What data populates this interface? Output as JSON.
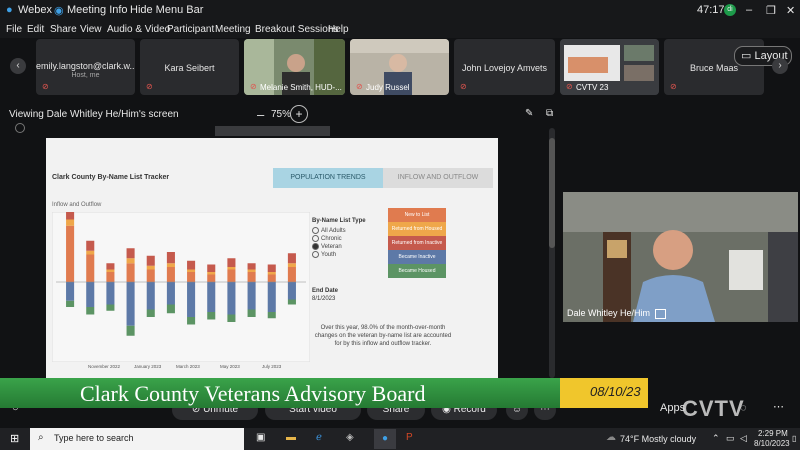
{
  "titlebar": {
    "app": "Webex",
    "meeting_info": "Meeting Info",
    "hide_menu": "Hide Menu Bar",
    "timer": "47:17"
  },
  "menu": [
    "File",
    "Edit",
    "Share",
    "View",
    "Audio & Video",
    "Participant",
    "Meeting",
    "Breakout Sessions",
    "Help"
  ],
  "participants": [
    {
      "name": "emily.langston@clark.w...",
      "sub": "Host, me",
      "type": "name"
    },
    {
      "name": "Kara Seibert",
      "sub": "",
      "type": "name"
    },
    {
      "name": "",
      "caption": "Melanie Smith, HUD-...",
      "type": "video"
    },
    {
      "name": "",
      "caption": "Judy Russel",
      "type": "video"
    },
    {
      "name": "John Lovejoy Amvets",
      "sub": "",
      "type": "name"
    },
    {
      "name": "",
      "caption": "CVTV 23",
      "type": "video"
    },
    {
      "name": "Bruce Maas",
      "sub": "",
      "type": "name"
    }
  ],
  "layout_label": "Layout",
  "viewing": "Viewing Dale Whitley He/Him's screen",
  "zoom": "75%",
  "tracker": {
    "title": "Clark County By-Name List Tracker",
    "tab_active": "POPULATION TRENDS",
    "tab_inactive": "INFLOW AND OUTFLOW",
    "chart_title": "Inflow and Outflow",
    "filter_title": "By-Name List Type",
    "options": [
      "All Adults",
      "Chronic",
      "Veteran",
      "Youth"
    ],
    "selected": "Veteran",
    "legend": [
      {
        "label": "New to List",
        "color": "#e07b4f"
      },
      {
        "label": "Returned from Housed",
        "color": "#efa74a"
      },
      {
        "label": "Returned from Inactive",
        "color": "#c55a4d"
      },
      {
        "label": "Became Inactive",
        "color": "#5d79a7"
      },
      {
        "label": "Became Housed",
        "color": "#5c9464"
      }
    ],
    "end_date_label": "End Date",
    "end_date": "8/1/2023",
    "note": "Over this year, 98.0% of the month-over-month changes on the veteran by-name list are accounted for by this inflow and outflow tracker.",
    "x_ticks": [
      "November 2022",
      "January 2023",
      "March 2023",
      "May 2023",
      "July 2023"
    ]
  },
  "chart_data": {
    "type": "bar",
    "title": "Inflow and Outflow",
    "categories": [
      "",
      "",
      "",
      "",
      "",
      "",
      "",
      "",
      "",
      "",
      "",
      ""
    ],
    "series": [
      {
        "name": "New to List",
        "values": [
          45,
          22,
          8,
          15,
          10,
          12,
          8,
          6,
          10,
          8,
          6,
          12
        ]
      },
      {
        "name": "Returned from Housed",
        "values": [
          5,
          3,
          2,
          4,
          3,
          3,
          2,
          2,
          2,
          2,
          2,
          3
        ]
      },
      {
        "name": "Returned from Inactive",
        "values": [
          12,
          8,
          5,
          8,
          8,
          9,
          7,
          6,
          7,
          5,
          6,
          8
        ]
      },
      {
        "name": "Became Inactive",
        "values": [
          -15,
          -20,
          -18,
          -35,
          -22,
          -18,
          -28,
          -24,
          -26,
          -22,
          -24,
          -14
        ]
      },
      {
        "name": "Became Housed",
        "values": [
          -5,
          -6,
          -5,
          -8,
          -6,
          -7,
          -6,
          -6,
          -6,
          -6,
          -5,
          -4
        ]
      }
    ]
  },
  "presenter_caption": "Dale Whitley He/Him",
  "banner": {
    "title": "Clark County Veterans Advisory Board",
    "date": "08/10/23",
    "brand": "CVTV"
  },
  "controls": [
    "Unmute",
    "Start video",
    "Share",
    "Record",
    "Apps"
  ],
  "taskbar": {
    "search": "Type here to search",
    "weather": "74°F  Mostly cloudy",
    "time": "2:29 PM",
    "date": "8/10/2023"
  }
}
